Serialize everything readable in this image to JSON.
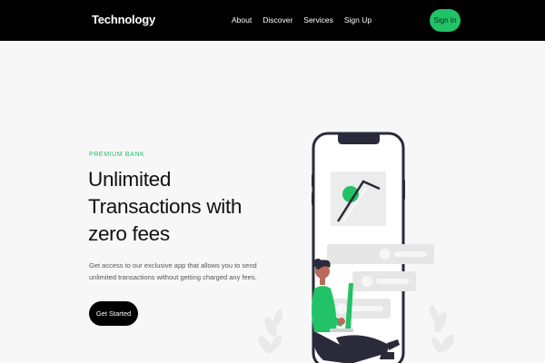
{
  "brand": "Technology",
  "nav": {
    "items": [
      "About",
      "Discover",
      "Services",
      "Sign Up"
    ],
    "signin_label": "Sign In"
  },
  "hero": {
    "eyebrow": "PREMIUM BANK",
    "headline_lines": [
      "Unlimited",
      "Transactions with",
      "zero fees"
    ],
    "subtext_lines": [
      "Get access to our exclusive app that allows you to send",
      "unlimited transactions without getting charged any fees."
    ],
    "cta_label": "Get Started"
  },
  "colors": {
    "navbar": "#000000",
    "accent": "#22c266",
    "background": "#f7f7f7"
  },
  "illustration": {
    "description_icon": "phone-with-person-icon"
  }
}
